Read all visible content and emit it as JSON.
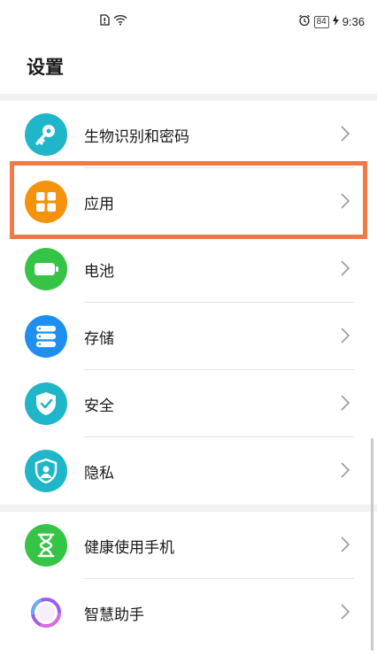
{
  "status_bar": {
    "time": "9:36",
    "battery": "84",
    "icons": [
      "sim-card-icon",
      "wifi-icon",
      "alarm-icon",
      "battery-icon",
      "charging-icon"
    ]
  },
  "header": {
    "title": "设置"
  },
  "settings_items": [
    {
      "label": "生物识别和密码",
      "icon": "key-icon",
      "color": "#1fb6c9"
    },
    {
      "label": "应用",
      "icon": "apps-grid-icon",
      "color": "#f5920c"
    },
    {
      "label": "电池",
      "icon": "battery-icon",
      "color": "#36c447"
    },
    {
      "label": "存储",
      "icon": "storage-icon",
      "color": "#1e8ff0"
    },
    {
      "label": "安全",
      "icon": "shield-check-icon",
      "color": "#1fb6c9"
    },
    {
      "label": "隐私",
      "icon": "privacy-icon",
      "color": "#1fb6c9"
    },
    {
      "label": "健康使用手机",
      "icon": "hourglass-icon",
      "color": "#36c447"
    },
    {
      "label": "智慧助手",
      "icon": "assistant-icon",
      "color": "#9c5cf0"
    }
  ],
  "highlight_color": "#f07a45"
}
